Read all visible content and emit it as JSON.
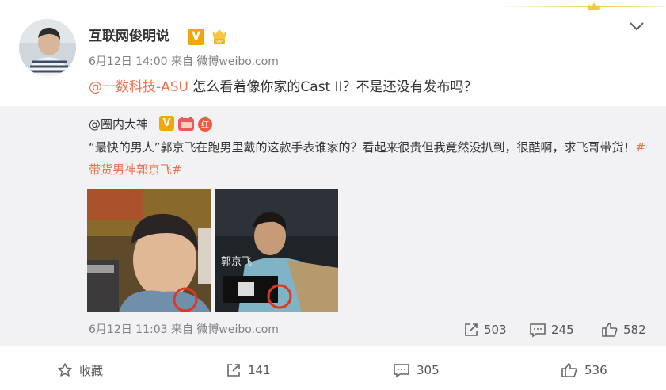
{
  "post": {
    "author": "互联网俊明说",
    "verified_badge": "V",
    "meta": "6月12日 14:00 来自 微博weibo.com",
    "mention": "@一数科技-ASU",
    "text": " 怎么看着像你家的Cast II？不是还没有发布吗？",
    "icons": {
      "options": "chevron-down-icon",
      "vip": "vip-icon",
      "decoration": "crown-icon"
    }
  },
  "repost": {
    "author": "@圈内大神",
    "verified_badge": "V",
    "red_badge": "红",
    "text": "“最快的男人”郭京飞在跑男里戴的这款手表谁家的？看起来很贵但我竟然没扒到，很酷啊，求飞哥带货！",
    "hashtag": "#带货男神郭京飞#",
    "meta": "6月12日 11:03 来自 微博weibo.com",
    "photo_captions": [
      "郭京飞"
    ],
    "stats": {
      "reposts": "503",
      "comments": "245",
      "likes": "582"
    }
  },
  "actions": {
    "favorite_label": "收藏",
    "repost_count": "141",
    "comment_count": "305",
    "like_count": "536"
  },
  "colors": {
    "accent": "#eb7350",
    "badge": "#f2a60a",
    "repost_bg": "#f2f2f5",
    "muted": "#808080"
  }
}
